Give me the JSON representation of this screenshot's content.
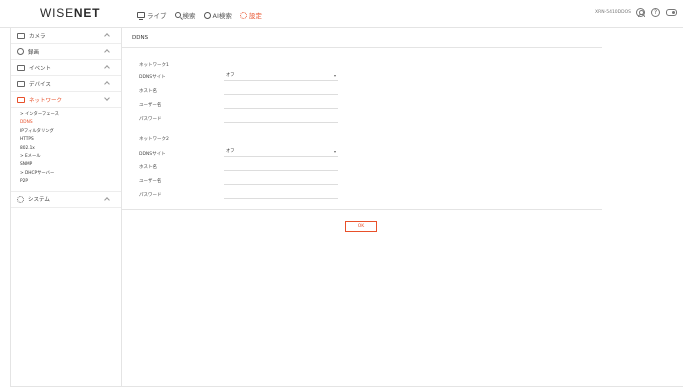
{
  "app": {
    "logo_light": "WISE",
    "logo_bold": "NET"
  },
  "topnav": [
    {
      "label": "ライブ",
      "icon": "monitor-icon",
      "active": false
    },
    {
      "label": "検索",
      "icon": "search-icon",
      "active": false
    },
    {
      "label": "AI検索",
      "icon": "ai-search-icon",
      "active": false
    },
    {
      "label": "設定",
      "icon": "gear-icon",
      "active": true
    }
  ],
  "topright": {
    "user_id": "XRN-5410DDOS"
  },
  "sidebar": {
    "menus": [
      {
        "label": "カメラ",
        "icon": "camera-icon"
      },
      {
        "label": "録画",
        "icon": "record-icon"
      },
      {
        "label": "イベント",
        "icon": "event-icon"
      },
      {
        "label": "デバイス",
        "icon": "device-icon"
      },
      {
        "label": "ネットワーク",
        "icon": "network-icon"
      },
      {
        "label": "システム",
        "icon": "system-icon"
      }
    ],
    "network_sub": [
      {
        "label": "> インターフェース"
      },
      {
        "label": "DDNS"
      },
      {
        "label": "IPフィルタリング"
      },
      {
        "label": "HTTPS"
      },
      {
        "label": "802.1x"
      },
      {
        "label": "> Eメール"
      },
      {
        "label": "SNMP"
      },
      {
        "label": "> DHCPサーバー"
      },
      {
        "label": "P2P"
      }
    ]
  },
  "main": {
    "title": "DDNS",
    "network1": {
      "title": "ネットワーク1",
      "ddns_site_label": "DDNSサイト",
      "ddns_site_value": "オフ",
      "host_label": "ホスト名",
      "user_label": "ユーザー名",
      "password_label": "パスワード"
    },
    "network2": {
      "title": "ネットワーク2",
      "ddns_site_label": "DDNSサイト",
      "ddns_site_value": "オフ",
      "host_label": "ホスト名",
      "user_label": "ユーザー名",
      "password_label": "パスワード"
    },
    "ok_label": "OK"
  },
  "colors": {
    "accent": "#e8502a"
  }
}
